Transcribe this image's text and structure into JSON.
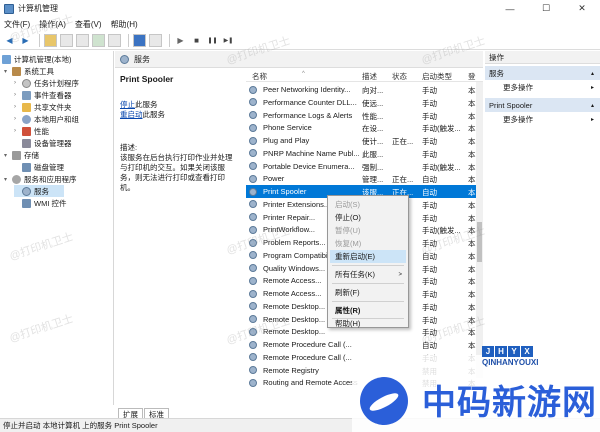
{
  "window": {
    "title": "计算机管理",
    "controls": {
      "minimize": "—",
      "maximize": "☐",
      "close": "✕"
    }
  },
  "menubar": [
    "文件(F)",
    "操作(A)",
    "查看(V)",
    "帮助(H)"
  ],
  "toolbar": {
    "icons": [
      "back-icon",
      "forward-icon",
      "up-folder-icon",
      "console-tree-icon",
      "properties-icon",
      "refresh-icon",
      "export-icon",
      "help-icon",
      "show-pane-icon",
      "play-icon",
      "stop-icon",
      "pause-icon",
      "restart-icon"
    ],
    "glyphs": {
      "back": "◀",
      "forward": "▶",
      "play": "▶",
      "stop": "■",
      "pause": "❚❚",
      "restart": "▶❚"
    }
  },
  "tree": {
    "root": "计算机管理(本地)",
    "items": [
      {
        "label": "系统工具",
        "level": 1,
        "arrow": "▾"
      },
      {
        "label": "任务计划程序",
        "level": 2,
        "arrow": "›"
      },
      {
        "label": "事件查看器",
        "level": 2,
        "arrow": "›"
      },
      {
        "label": "共享文件夹",
        "level": 2,
        "arrow": "›"
      },
      {
        "label": "本地用户和组",
        "level": 2,
        "arrow": "›"
      },
      {
        "label": "性能",
        "level": 2,
        "arrow": "›"
      },
      {
        "label": "设备管理器",
        "level": 2,
        "arrow": ""
      },
      {
        "label": "存储",
        "level": 1,
        "arrow": "▾"
      },
      {
        "label": "磁盘管理",
        "level": 2,
        "arrow": ""
      },
      {
        "label": "服务和应用程序",
        "level": 1,
        "arrow": "▾"
      },
      {
        "label": "服务",
        "level": 2,
        "arrow": ""
      },
      {
        "label": "WMI 控件",
        "level": 2,
        "arrow": ""
      }
    ]
  },
  "center": {
    "header": "服务",
    "selected_service": "Print Spooler",
    "stop_link": "停止",
    "stop_suffix": "此服务",
    "restart_link": "重启动",
    "restart_suffix": "此服务",
    "desc_label": "描述:",
    "desc_text": "该服务在后台执行打印作业并处理与打印机的交互。如果关闭该服务，则无法进行打印或查看打印机。",
    "columns": {
      "name": "名称",
      "desc": "描述",
      "status": "状态",
      "startup": "启动类型",
      "logon": "登"
    },
    "sort_indicator": "^",
    "rows": [
      {
        "name": "Peer Networking Identity...",
        "desc": "向对...",
        "status": "",
        "startup": "手动",
        "logon": "本"
      },
      {
        "name": "Performance Counter DLL...",
        "desc": "使远...",
        "status": "",
        "startup": "手动",
        "logon": "本"
      },
      {
        "name": "Performance Logs & Alerts",
        "desc": "性能...",
        "status": "",
        "startup": "手动",
        "logon": "本"
      },
      {
        "name": "Phone Service",
        "desc": "在设...",
        "status": "",
        "startup": "手动(触发...",
        "logon": "本"
      },
      {
        "name": "Plug and Play",
        "desc": "使计...",
        "status": "正在...",
        "startup": "手动",
        "logon": "本"
      },
      {
        "name": "PNRP Machine Name Publ...",
        "desc": "此服...",
        "status": "",
        "startup": "手动",
        "logon": "本"
      },
      {
        "name": "Portable Device Enumera...",
        "desc": "强制...",
        "status": "",
        "startup": "手动(触发...",
        "logon": "本"
      },
      {
        "name": "Power",
        "desc": "管理...",
        "status": "正在...",
        "startup": "自动",
        "logon": "本"
      },
      {
        "name": "Print Spooler",
        "desc": "该服...",
        "status": "正在...",
        "startup": "自动",
        "logon": "本"
      },
      {
        "name": "Printer Extensions...",
        "desc": "",
        "status": "",
        "startup": "手动",
        "logon": "本"
      },
      {
        "name": "Printer Repair...",
        "desc": "",
        "status": "",
        "startup": "手动",
        "logon": "本"
      },
      {
        "name": "PrintWorkflow...",
        "desc": "",
        "status": "",
        "startup": "手动(触发...",
        "logon": "本"
      },
      {
        "name": "Problem Reports...",
        "desc": "",
        "status": "",
        "startup": "手动",
        "logon": "本"
      },
      {
        "name": "Program Compatibility...",
        "desc": "",
        "status": "",
        "startup": "自动",
        "logon": "本"
      },
      {
        "name": "Quality Windows...",
        "desc": "",
        "status": "",
        "startup": "手动",
        "logon": "本"
      },
      {
        "name": "Remote Access...",
        "desc": "",
        "status": "",
        "startup": "手动",
        "logon": "本"
      },
      {
        "name": "Remote Access...",
        "desc": "",
        "status": "",
        "startup": "手动",
        "logon": "本"
      },
      {
        "name": "Remote Desktop...",
        "desc": "",
        "status": "",
        "startup": "手动",
        "logon": "本"
      },
      {
        "name": "Remote Desktop...",
        "desc": "",
        "status": "",
        "startup": "手动",
        "logon": "本"
      },
      {
        "name": "Remote Desktop...",
        "desc": "",
        "status": "",
        "startup": "手动",
        "logon": "本"
      },
      {
        "name": "Remote Procedure Call (...",
        "desc": "",
        "status": "",
        "startup": "自动",
        "logon": "本"
      },
      {
        "name": "Remote Procedure Call (...",
        "desc": "",
        "status": "",
        "startup": "手动",
        "logon": "本"
      },
      {
        "name": "Remote Registry",
        "desc": "",
        "status": "",
        "startup": "禁用",
        "logon": "本"
      },
      {
        "name": "Routing and Remote Access",
        "desc": "",
        "status": "",
        "startup": "禁用",
        "logon": "本"
      }
    ],
    "tabs": [
      "扩展",
      "标准"
    ]
  },
  "context_menu": {
    "items": [
      {
        "label": "启动(S)",
        "disabled": true
      },
      {
        "label": "停止(O)",
        "disabled": false
      },
      {
        "label": "暂停(U)",
        "disabled": true
      },
      {
        "label": "恢复(M)",
        "disabled": true
      },
      {
        "label": "重新启动(E)",
        "disabled": false,
        "highlighted": true
      },
      {
        "label": "所有任务(K)",
        "disabled": false,
        "submenu": true
      },
      {
        "label": "刷新(F)",
        "disabled": false
      },
      {
        "label": "属性(R)",
        "disabled": false,
        "bold": true
      },
      {
        "label": "帮助(H)",
        "disabled": false
      }
    ],
    "submenu_glyph": ">"
  },
  "actions": {
    "title": "操作",
    "groups": [
      {
        "label": "服务",
        "item": "更多操作"
      },
      {
        "label": "Print Spooler",
        "item": "更多操作"
      }
    ],
    "glyph_collapse": "▴",
    "glyph_more": "▸"
  },
  "statusbar": "停止并启动 本地计算机 上的服务 Print Spooler",
  "watermarks": [
    "@打印机卫士",
    "@打印机卫士",
    "@打印机卫士",
    "@打印机卫士",
    "@打印机卫士",
    "@打印机卫士",
    "@打印机卫士",
    "@打印机卫士",
    "@打印机卫士"
  ],
  "logo": {
    "letters": [
      "J",
      "H",
      "Y",
      "X"
    ],
    "en": "QINHANYOUXI",
    "cn": "中码新游网"
  },
  "colors": {
    "selection": "#0078d7",
    "link": "#0645ad",
    "logo_blue": "#2b5fd9",
    "ctx_highlight": "#cce4f7"
  }
}
